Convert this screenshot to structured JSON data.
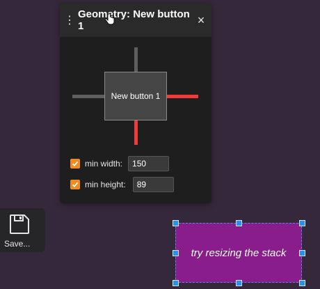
{
  "geometry_panel": {
    "menu_icon": "vertical-dots-icon",
    "title": "Geometry: New button 1",
    "close_icon": "close-icon",
    "close_label": "×",
    "anchors": {
      "top": "off",
      "bottom": "on",
      "left": "off",
      "right": "on"
    },
    "element_label": "New button 1",
    "min_width": {
      "checked": true,
      "label": "min width:",
      "value": "150"
    },
    "min_height": {
      "checked": true,
      "label": "min height:",
      "value": "89"
    }
  },
  "save_button": {
    "icon": "floppy-disk-icon",
    "label": "Save..."
  },
  "stack": {
    "label": "try resizing the stack"
  },
  "colors": {
    "background": "#35283b",
    "panel": "#1f1e1f",
    "anchor_active": "#ef3b3b",
    "anchor_inactive": "#5e5e5e",
    "checkbox": "#f08c1f",
    "stack_fill": "#8a1d8c",
    "selection": "#2b8ff0"
  }
}
